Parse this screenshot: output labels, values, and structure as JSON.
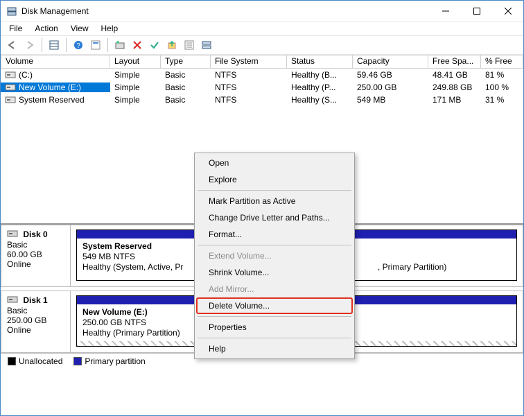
{
  "window": {
    "title": "Disk Management"
  },
  "menu": {
    "file": "File",
    "action": "Action",
    "view": "View",
    "help": "Help"
  },
  "columns": {
    "volume": "Volume",
    "layout": "Layout",
    "type": "Type",
    "fs": "File System",
    "status": "Status",
    "capacity": "Capacity",
    "free": "Free Spa...",
    "pfree": "% Free"
  },
  "volumes": [
    {
      "name": "(C:)",
      "layout": "Simple",
      "type": "Basic",
      "fs": "NTFS",
      "status": "Healthy (B...",
      "capacity": "59.46 GB",
      "free": "48.41 GB",
      "pfree": "81 %"
    },
    {
      "name": "New Volume (E:)",
      "layout": "Simple",
      "type": "Basic",
      "fs": "NTFS",
      "status": "Healthy (P...",
      "capacity": "250.00 GB",
      "free": "249.88 GB",
      "pfree": "100 %"
    },
    {
      "name": "System Reserved",
      "layout": "Simple",
      "type": "Basic",
      "fs": "NTFS",
      "status": "Healthy (S...",
      "capacity": "549 MB",
      "free": "171 MB",
      "pfree": "31 %"
    }
  ],
  "disks": [
    {
      "id": "Disk 0",
      "type": "Basic",
      "size": "60.00 GB",
      "status": "Online",
      "parts": [
        {
          "title": "System Reserved",
          "line2": "549 MB NTFS",
          "line3": "Healthy (System, Active, Pr",
          "hatched": false
        },
        {
          "title": "",
          "line2": "",
          "line3": ", Primary Partition)",
          "hatched": false
        }
      ]
    },
    {
      "id": "Disk 1",
      "type": "Basic",
      "size": "250.00 GB",
      "status": "Online",
      "parts": [
        {
          "title": "New Volume  (E:)",
          "line2": "250.00 GB NTFS",
          "line3": "Healthy (Primary Partition)",
          "hatched": true
        }
      ]
    }
  ],
  "legend": {
    "unallocated": "Unallocated",
    "primary": "Primary partition"
  },
  "context_menu": {
    "open": "Open",
    "explore": "Explore",
    "mark_active": "Mark Partition as Active",
    "change_letter": "Change Drive Letter and Paths...",
    "format": "Format...",
    "extend": "Extend Volume...",
    "shrink": "Shrink Volume...",
    "add_mirror": "Add Mirror...",
    "delete": "Delete Volume...",
    "properties": "Properties",
    "help": "Help"
  }
}
